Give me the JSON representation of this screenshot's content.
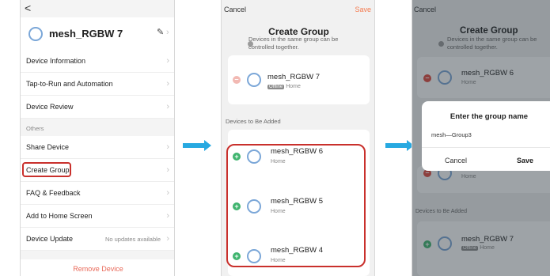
{
  "screen1": {
    "back_glyph": "<",
    "device_name": "mesh_RGBW 7",
    "edit_glyph": "✎",
    "rows": [
      {
        "label": "Device Information"
      },
      {
        "label": "Tap-to-Run and Automation"
      },
      {
        "label": "Device Review"
      }
    ],
    "section_label": "Others",
    "rows2": [
      {
        "label": "Share Device"
      },
      {
        "label": "Create Group"
      },
      {
        "label": "FAQ & Feedback"
      },
      {
        "label": "Add to Home Screen"
      },
      {
        "label": "Device Update",
        "value": "No updates available"
      }
    ],
    "remove_label": "Remove Device"
  },
  "screen2": {
    "cancel_label": "Cancel",
    "save_label": "Save",
    "title": "Create Group",
    "description": "Devices in the same group can be controlled together.",
    "current_device": {
      "name": "mesh_RGBW 7",
      "status": "Offline",
      "room": "Home"
    },
    "section_label": "Devices to Be Added",
    "devices": [
      {
        "name": "mesh_RGBW 6",
        "room": "Home"
      },
      {
        "name": "mesh_RGBW 5",
        "room": "Home"
      },
      {
        "name": "mesh_RGBW 4",
        "room": "Home"
      }
    ]
  },
  "screen3": {
    "cancel_label": "Cancel",
    "title": "Create Group",
    "description": "Devices in the same group can be controlled together.",
    "current_device": {
      "name": "mesh_RGBW 6",
      "room": "Home"
    },
    "partial_room": "Home",
    "section_label": "Devices to Be Added",
    "bottom_device": {
      "name": "mesh_RGBW 7",
      "status": "Offline",
      "room": "Home"
    },
    "dialog": {
      "title": "Enter the group name",
      "input_value": "mesh—Group3",
      "cancel_label": "Cancel",
      "save_label": "Save"
    }
  },
  "colors": {
    "accent_arrow": "#27a9e1",
    "highlight_red": "#c9302c",
    "save_orange": "#f47b50",
    "remove_red": "#e96a5a",
    "add_green": "#3fb46e"
  }
}
